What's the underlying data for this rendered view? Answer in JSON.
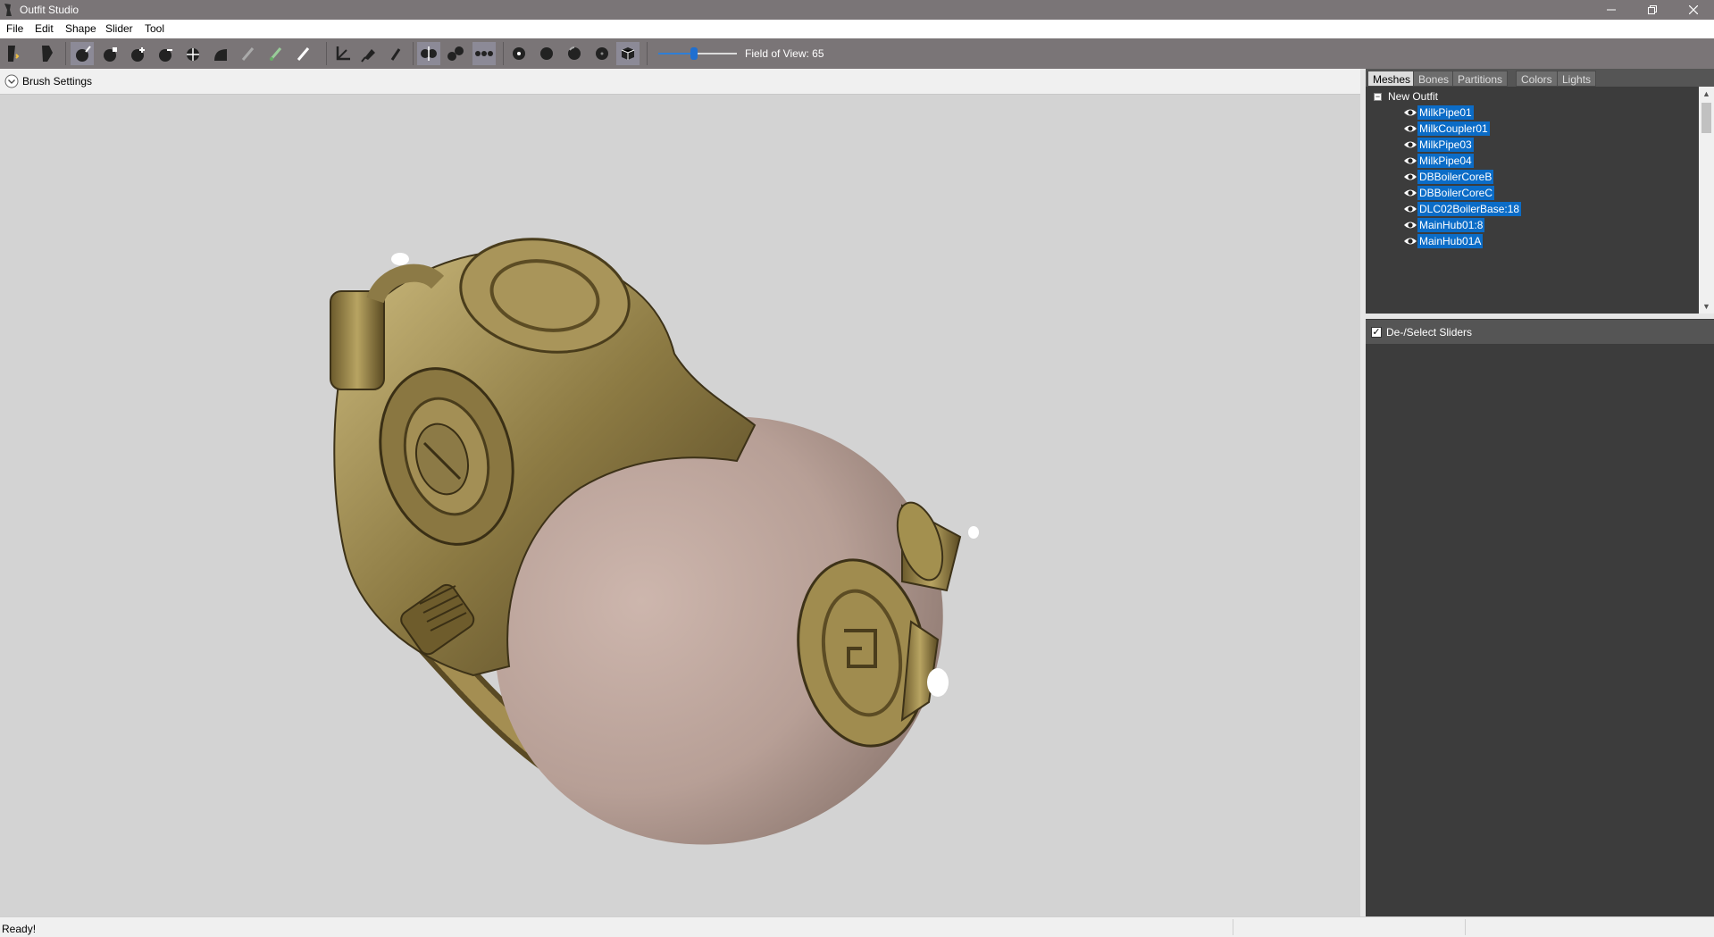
{
  "window": {
    "title": "Outfit Studio"
  },
  "menu": [
    "File",
    "Edit",
    "Shape",
    "Slider",
    "Tool"
  ],
  "toolbar": {
    "fov_label": "Field of View: 65",
    "fov_value": 65
  },
  "brush_settings": {
    "label": "Brush Settings"
  },
  "panel": {
    "tabs": [
      "Meshes",
      "Bones",
      "Partitions",
      "Colors",
      "Lights"
    ],
    "active_tab": "Meshes",
    "root": "New Outfit",
    "meshes": [
      "MilkPipe01",
      "MilkCoupler01",
      "MilkPipe03",
      "MilkPipe04",
      "DBBoilerCoreB",
      "DBBoilerCoreC",
      "DLC02BoilerBase:18",
      "MainHub01:8",
      "MainHub01A"
    ],
    "sliders_toggle": "De-/Select Sliders"
  },
  "status": {
    "text": "Ready!"
  },
  "colors": {
    "chrome": "#7a7577",
    "selection": "#0b6cc7",
    "viewport": "#d3d3d3",
    "panel": "#3c3c3c"
  }
}
